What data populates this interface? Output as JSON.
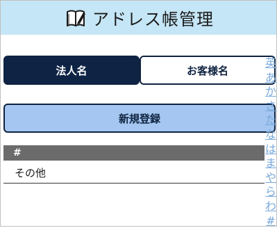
{
  "header": {
    "title": "アドレス帳管理",
    "icon": "book-pencil-icon"
  },
  "tabs": [
    {
      "label": "法人名",
      "active": true
    },
    {
      "label": "お客様名",
      "active": false
    }
  ],
  "register_button": {
    "label": "新規登録"
  },
  "list": {
    "group_label": "#",
    "items": [
      "その他"
    ]
  },
  "index_bar": [
    "英",
    "あ",
    "か",
    "さ",
    "た",
    "な",
    "は",
    "ま",
    "や",
    "ら",
    "わ",
    "#"
  ],
  "colors": {
    "header_bg": "#c5e6f6",
    "tab_active_bg": "#0f2445",
    "register_bg": "#a4c6f0",
    "group_header_bg": "#6b6b6b",
    "index_link": "#7aa9db"
  }
}
